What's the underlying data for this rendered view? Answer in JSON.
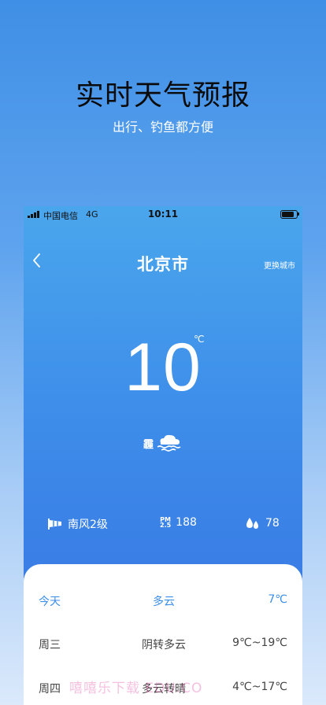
{
  "promo": {
    "title": "实时天气预报",
    "subtitle": "出行、钓鱼都方便"
  },
  "status_bar": {
    "carrier": "中国电信",
    "network": "4G",
    "time": "10:11",
    "signal_icon": "signal-bars-icon",
    "battery_icon": "battery-icon"
  },
  "header": {
    "back_icon": "chevron-left-icon",
    "city": "北京市",
    "change_city": "更换城市"
  },
  "current": {
    "temperature": "10",
    "unit": "℃",
    "condition": "霾",
    "condition_icon": "haze-cloud-icon"
  },
  "metrics": {
    "wind": {
      "icon": "windsock-icon",
      "value": "南风2级"
    },
    "pm": {
      "label_top": "PM",
      "label_bottom": "2.5",
      "value": "188"
    },
    "humidity": {
      "icon": "water-drops-icon",
      "value": "78"
    }
  },
  "forecast": [
    {
      "day": "今天",
      "condition": "多云",
      "range": "7℃"
    },
    {
      "day": "周三",
      "condition": "阴转多云",
      "range": "9℃~19℃"
    },
    {
      "day": "周四",
      "condition": "多云转晴",
      "range": "4℃~17℃"
    }
  ],
  "watermark": "嘻嘻乐下载 EDU.CO",
  "colors": {
    "accent": "#3b8eea",
    "phone_gradient_top": "#4aa6ec",
    "phone_gradient_bottom": "#3572e0"
  }
}
